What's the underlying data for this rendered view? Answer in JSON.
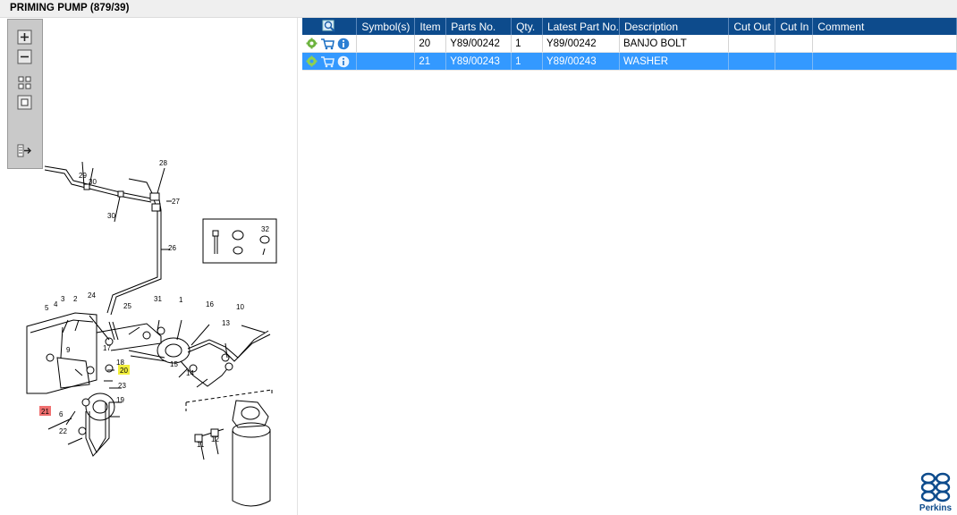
{
  "window": {
    "title": "PRIMING PUMP (879/39)"
  },
  "toolbar": {
    "zoom_in_icon": "plus-square-icon",
    "zoom_out_icon": "minus-square-icon",
    "fit_icon": "grid-icon",
    "reset_icon": "square-icon",
    "export_icon": "list-arrow-icon"
  },
  "diagram": {
    "callouts": [
      "1",
      "2",
      "3",
      "4",
      "5",
      "6",
      "9",
      "10",
      "11",
      "12",
      "13",
      "14",
      "15",
      "16",
      "17",
      "18",
      "19",
      "20",
      "21",
      "22",
      "23",
      "24",
      "25",
      "26",
      "27",
      "28",
      "29",
      "30",
      "30",
      "31",
      "32"
    ],
    "highlight_yellow": "20",
    "highlight_red": "21",
    "colors": {
      "yellow": "#f2ef3d",
      "red": "#f07070"
    }
  },
  "table": {
    "columns": [
      "Symbol(s)",
      "Item",
      "Parts No.",
      "Qty.",
      "Latest Part No.",
      "Description",
      "Cut Out",
      "Cut In",
      "Comment"
    ],
    "rows": [
      {
        "item": "20",
        "parts_no": "Y89/00242",
        "qty": "1",
        "latest_part_no": "Y89/00242",
        "description": "BANJO BOLT",
        "cut_out": "",
        "cut_in": "",
        "comment": "",
        "selected": false
      },
      {
        "item": "21",
        "parts_no": "Y89/00243",
        "qty": "1",
        "latest_part_no": "Y89/00243",
        "description": "WASHER",
        "cut_out": "",
        "cut_in": "",
        "comment": "",
        "selected": true
      }
    ],
    "row_icons": [
      "gear-icon",
      "cart-icon",
      "info-icon"
    ],
    "colors": {
      "header": "#0d4b8c",
      "selected": "#3399ff"
    }
  },
  "brand": {
    "name": "Perkins",
    "color": "#0d4b8c"
  }
}
